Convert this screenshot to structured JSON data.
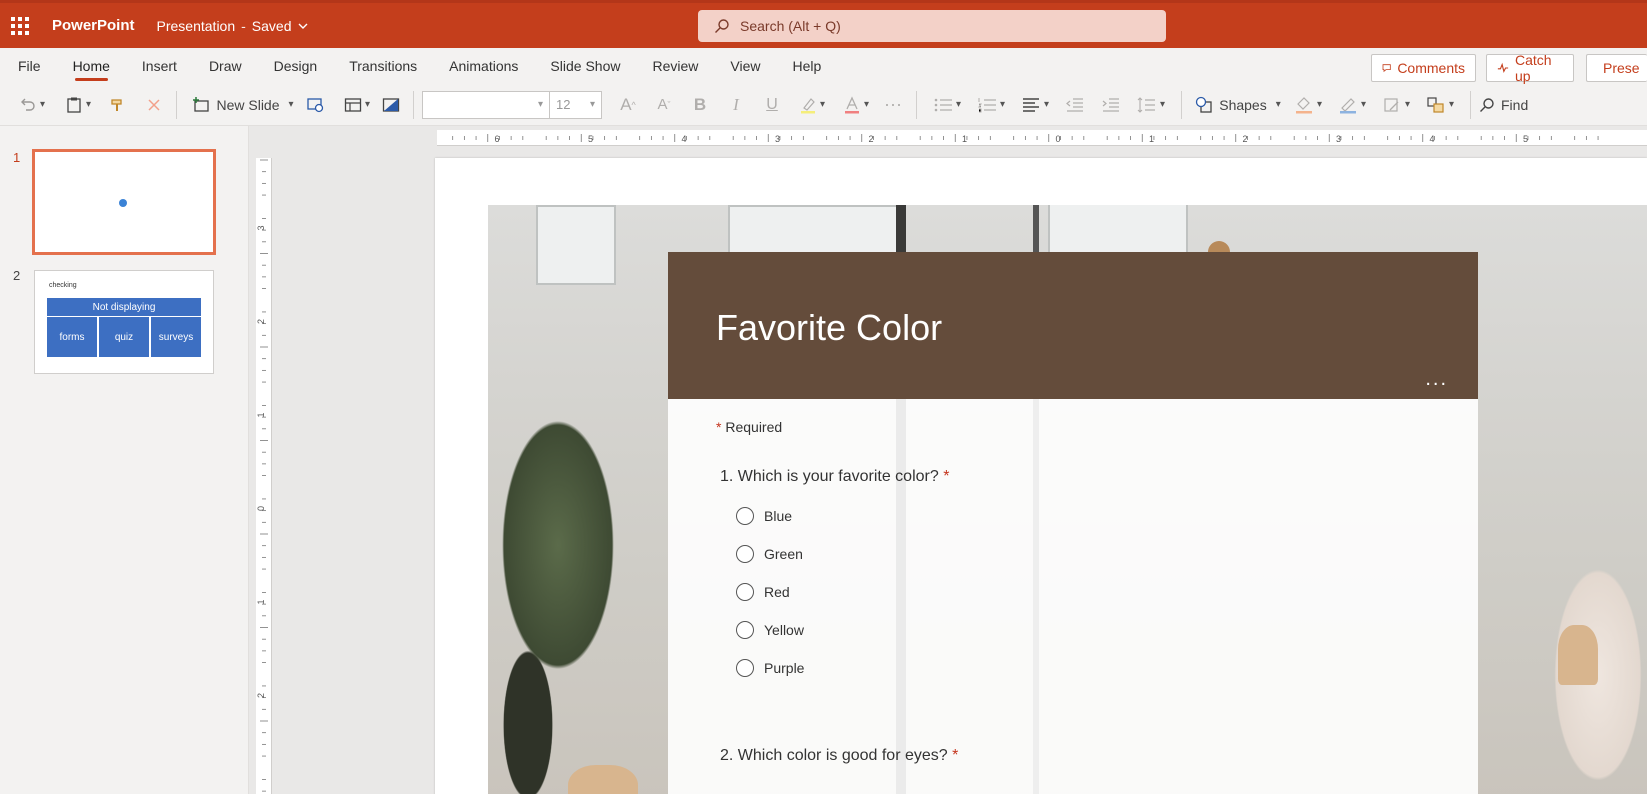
{
  "app": {
    "name": "PowerPoint",
    "document": "Presentation",
    "status": "Saved"
  },
  "search": {
    "placeholder": "Search (Alt + Q)"
  },
  "tabs": [
    {
      "label": "File"
    },
    {
      "label": "Home",
      "active": true
    },
    {
      "label": "Insert"
    },
    {
      "label": "Draw"
    },
    {
      "label": "Design"
    },
    {
      "label": "Transitions"
    },
    {
      "label": "Animations"
    },
    {
      "label": "Slide Show"
    },
    {
      "label": "Review"
    },
    {
      "label": "View"
    },
    {
      "label": "Help"
    }
  ],
  "tab_actions": {
    "comments": "Comments",
    "catchup": "Catch up",
    "present": "Prese"
  },
  "ribbon": {
    "new_slide": "New Slide",
    "font_size": "12",
    "shapes": "Shapes",
    "find": "Find"
  },
  "thumbnails": [
    {
      "number": "1"
    },
    {
      "number": "2",
      "title": "checking",
      "header": "Not displaying",
      "cells": [
        "forms",
        "quiz",
        "surveys"
      ]
    }
  ],
  "ruler": {
    "horizontal": [
      "6",
      "5",
      "4",
      "3",
      "2",
      "1",
      "0",
      "1",
      "2",
      "3",
      "4",
      "5"
    ],
    "vertical": [
      "3",
      "2",
      "1",
      "0",
      "1",
      "2"
    ]
  },
  "form": {
    "title": "Favorite Color",
    "more": "...",
    "required_star": "*",
    "required_label": "Required",
    "q1": {
      "number": "1.",
      "text": "Which is your favorite color?",
      "star": "*"
    },
    "options": [
      "Blue",
      "Green",
      "Red",
      "Yellow",
      "Purple"
    ],
    "q2": {
      "number": "2.",
      "text": "Which color is good for eyes?",
      "star": "*"
    }
  },
  "colors": {
    "brand": "#c43e1c",
    "form_header": "#644c3b",
    "thumb_table": "#3d6fc2",
    "selection": "#e4714d"
  }
}
